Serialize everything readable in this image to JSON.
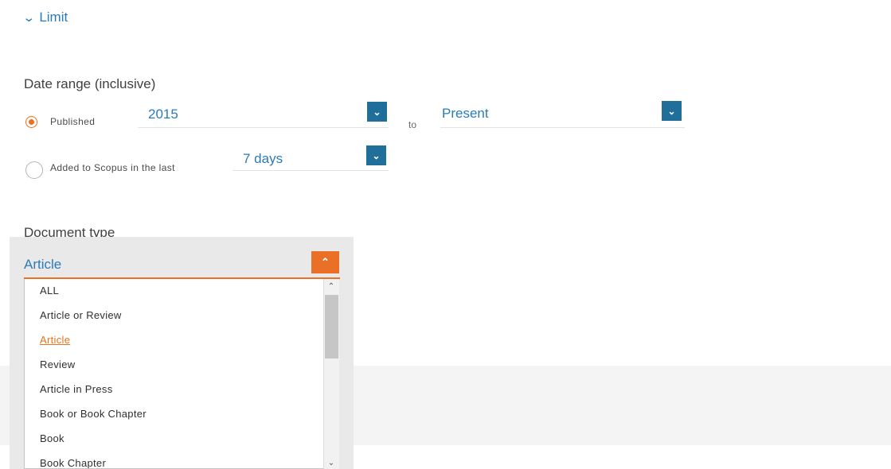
{
  "limit": {
    "icon": "chevron-down-icon",
    "label": "Limit"
  },
  "date_range": {
    "heading": "Date range (inclusive)",
    "published": {
      "label": "Published",
      "selected": true,
      "from_value": "2015",
      "to_label": "to",
      "to_value": "Present"
    },
    "added": {
      "label": "Added to Scopus in the last",
      "selected": false,
      "value": "7 days"
    }
  },
  "document_type": {
    "heading": "Document type",
    "selected": "Article",
    "options": [
      "ALL",
      "Article or Review",
      "Article",
      "Review",
      "Article in Press",
      "Book or Book Chapter",
      "Book",
      "Book Chapter"
    ]
  },
  "colors": {
    "accent_blue": "#2b7bb9",
    "button_blue": "#1f6f9a",
    "accent_orange": "#ea7027"
  }
}
